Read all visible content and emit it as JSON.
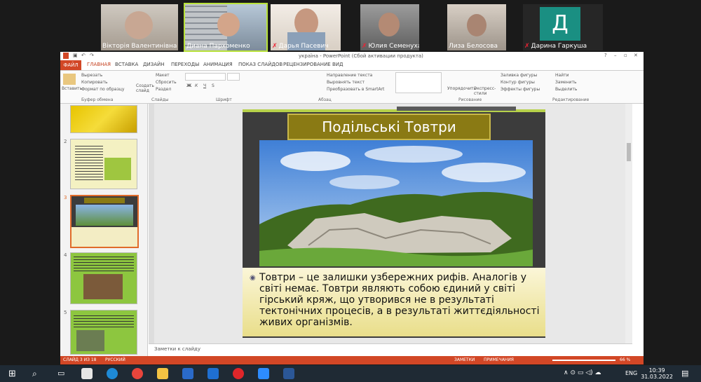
{
  "participants": [
    {
      "name": "Вікторія Валентинівна Ів...",
      "muted": false
    },
    {
      "name": "Диана Пархоменко",
      "muted": false,
      "active": true
    },
    {
      "name": "Дарья Пасевич",
      "muted": true
    },
    {
      "name": "Юлия Семенуха",
      "muted": true
    },
    {
      "name": "Лиза Белосова",
      "muted": false
    },
    {
      "name": "Дарина Гаркуша",
      "muted": true,
      "avatar_letter": "Д"
    }
  ],
  "ppt": {
    "window_title": "україна - PowerPoint (Сбой активации продукта)",
    "tabs": [
      "ФАЙЛ",
      "ГЛАВНАЯ",
      "ВСТАВКА",
      "ДИЗАЙН",
      "ПЕРЕХОДЫ",
      "АНИМАЦИЯ",
      "ПОКАЗ СЛАЙДОВ",
      "РЕЦЕНЗИРОВАНИЕ",
      "ВИД"
    ],
    "ribbon": {
      "paste": "Вставить",
      "cut": "Вырезать",
      "copy": "Копировать",
      "format_painter": "Формат по образцу",
      "clipboard_label": "Буфер обмена",
      "new_slide": "Создать слайд",
      "layout": "Макет",
      "reset": "Сбросить",
      "section": "Раздел",
      "slides_label": "Слайды",
      "font_label": "Шрифт",
      "paragraph_label": "Абзац",
      "text_direction": "Направление текста",
      "align_text": "Выровнять текст",
      "smartart": "Преобразовать в SmartArt",
      "arrange": "Упорядочить",
      "quick_styles": "Экспресс-стили",
      "shape_fill": "Заливка фигуры",
      "shape_outline": "Контур фигуры",
      "shape_effects": "Эффекты фигуры",
      "drawing_label": "Рисование",
      "find": "Найти",
      "replace": "Заменить",
      "select": "Выделить",
      "editing_label": "Редактирование"
    },
    "slide_numbers": [
      "2",
      "3",
      "4",
      "5"
    ],
    "slide": {
      "title": "Подільські Товтри",
      "body": "Товтри – це залишки узбережних рифів. Аналогів у світі немає. Товтри являють собою єдиний у світі гірський кряж, що утворився не в результаті тектонічних процесів, а в результаті життєдіяльності живих організмів."
    },
    "notes_placeholder": "Заметки к слайду",
    "status": {
      "slide_info": "СЛАЙД 3 ИЗ 18",
      "language": "РУССКИЙ",
      "notes": "ЗАМЕТКИ",
      "comments": "ПРИМЕЧАНИЯ",
      "zoom": "66 %"
    }
  },
  "taskbar": {
    "lang": "ENG",
    "time": "10:39",
    "date": "31.03.2022"
  },
  "colors": {
    "accent": "#d24726",
    "title_gold": "#8a7a14"
  }
}
